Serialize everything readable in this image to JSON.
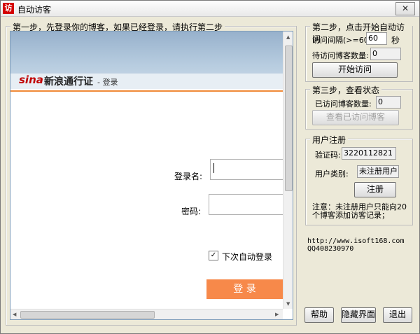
{
  "window": {
    "title": "自动访客",
    "close_symbol": "✕",
    "icon_glyph": "访"
  },
  "step1": {
    "label": "第一步，先登录你的博客，如果已经登录，请执行第二步",
    "browser": {
      "logo_text": "sina",
      "cert_text": "新浪通行证",
      "page_title": "- 登录",
      "username_label": "登录名:",
      "username_value": "",
      "password_label": "密码:",
      "password_value": "",
      "auto_login_label": "下次自动登录",
      "auto_login_checked": "✓",
      "login_button": "登 录"
    }
  },
  "step2": {
    "label": "第二步，点击开始自动访问",
    "interval_label": "访问间隔(>=60)",
    "interval_value": "60",
    "interval_unit": "秒",
    "pending_label": "待访问博客数量:",
    "pending_value": "0",
    "start_button": "开始访问"
  },
  "step3": {
    "label": "第三步，查看状态",
    "visited_label": "已访问博客数量:",
    "visited_value": "0",
    "view_button": "查看已访问博客"
  },
  "register": {
    "label": "用户注册",
    "code_label": "验证码:",
    "code_value": "3220112821",
    "type_label": "用户类别:",
    "type_value": "未注册用户",
    "register_button": "注册",
    "notice": "注意：未注册用户只能向20个博客添加访客记录；"
  },
  "contact": {
    "url": "http://www.isoft168.com",
    "qq": "QQ408230970"
  },
  "bottom": {
    "help_button": "帮助",
    "hide_button": "隐藏界面",
    "exit_button": "退出"
  },
  "colors": {
    "accent": "#f7894a",
    "logo_red": "#c10000"
  }
}
